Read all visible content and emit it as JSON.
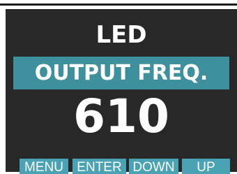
{
  "display": {
    "title": "LED",
    "menu_item": "OUTPUT FREQ.",
    "value": "610"
  },
  "softkeys": {
    "menu": "MENU",
    "enter": "ENTER",
    "down": "DOWN",
    "up": "UP"
  },
  "colors": {
    "screen_background": "#282828",
    "highlight": "#3e919c",
    "softkey": "#4aa3b5",
    "text": "#ffffff"
  }
}
